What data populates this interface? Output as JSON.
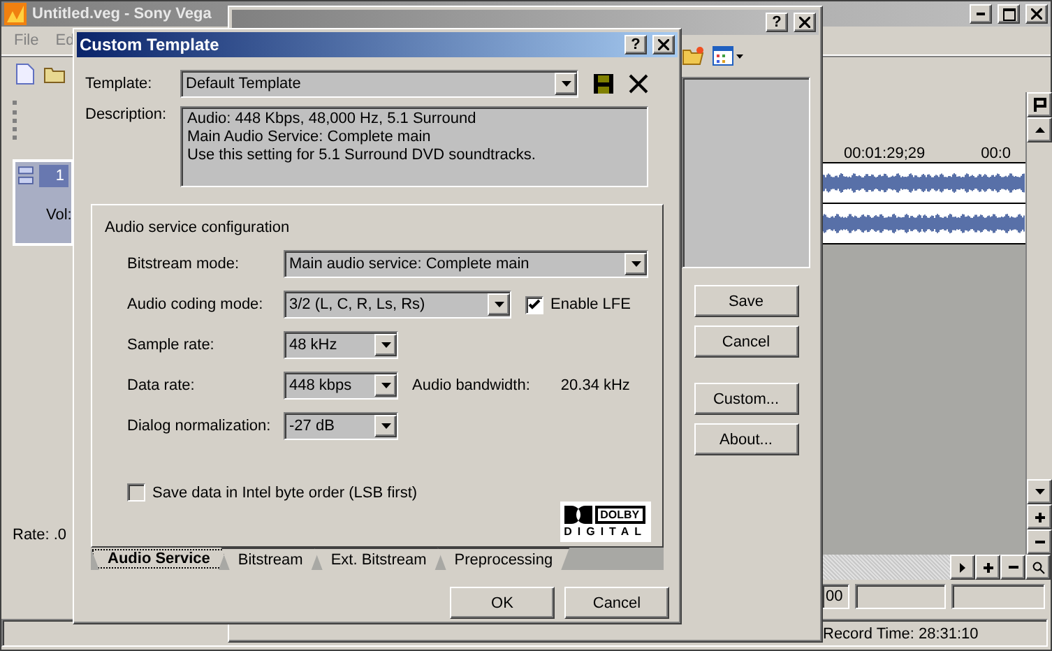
{
  "main_window": {
    "title": "Untitled.veg - Sony Vega",
    "menu": [
      "File",
      "Ed"
    ],
    "track": {
      "number": "1",
      "volume_label": "Vol:"
    },
    "rate_label": "Rate: .0",
    "ruler": [
      "00:01:29;29",
      "00:0"
    ],
    "time_field": "00",
    "status": "Record Time: 28:31:10"
  },
  "render_window": {
    "help": "?",
    "buttons": [
      "Save",
      "Cancel",
      "Custom...",
      "About..."
    ]
  },
  "dialog": {
    "title": "Custom Template",
    "help": "?",
    "template": {
      "label": "Template:",
      "value": "Default Template"
    },
    "description": {
      "label": "Description:",
      "lines": [
        "Audio: 448 Kbps, 48,000 Hz, 5.1 Surround",
        "Main Audio Service: Complete main",
        "Use this setting for 5.1 Surround DVD soundtracks."
      ]
    },
    "group_title": "Audio service configuration",
    "fields": [
      {
        "label": "Bitstream mode:",
        "value": "Main audio service: Complete main"
      },
      {
        "label": "Audio coding mode:",
        "value": "3/2 (L, C, R, Ls, Rs)",
        "extra": {
          "kind": "checkbox",
          "label": "Enable LFE",
          "checked": true
        }
      },
      {
        "label": "Sample rate:",
        "value": "48 kHz"
      },
      {
        "label": "Data rate:",
        "value": "448 kbps",
        "extra": {
          "kind": "reading",
          "label": "Audio bandwidth:",
          "value": "20.34 kHz"
        }
      },
      {
        "label": "Dialog normalization:",
        "value": "-27 dB"
      }
    ],
    "intel_order": {
      "label": "Save data in Intel byte order (LSB first)",
      "checked": false
    },
    "logo": {
      "top": "DOLBY",
      "bottom": "DIGITAL"
    },
    "tabs": [
      {
        "label": "Audio Service",
        "selected": true
      },
      {
        "label": "Bitstream",
        "selected": false
      },
      {
        "label": "Ext. Bitstream",
        "selected": false
      },
      {
        "label": "Preprocessing",
        "selected": false
      }
    ],
    "buttons": [
      "OK",
      "Cancel"
    ]
  }
}
